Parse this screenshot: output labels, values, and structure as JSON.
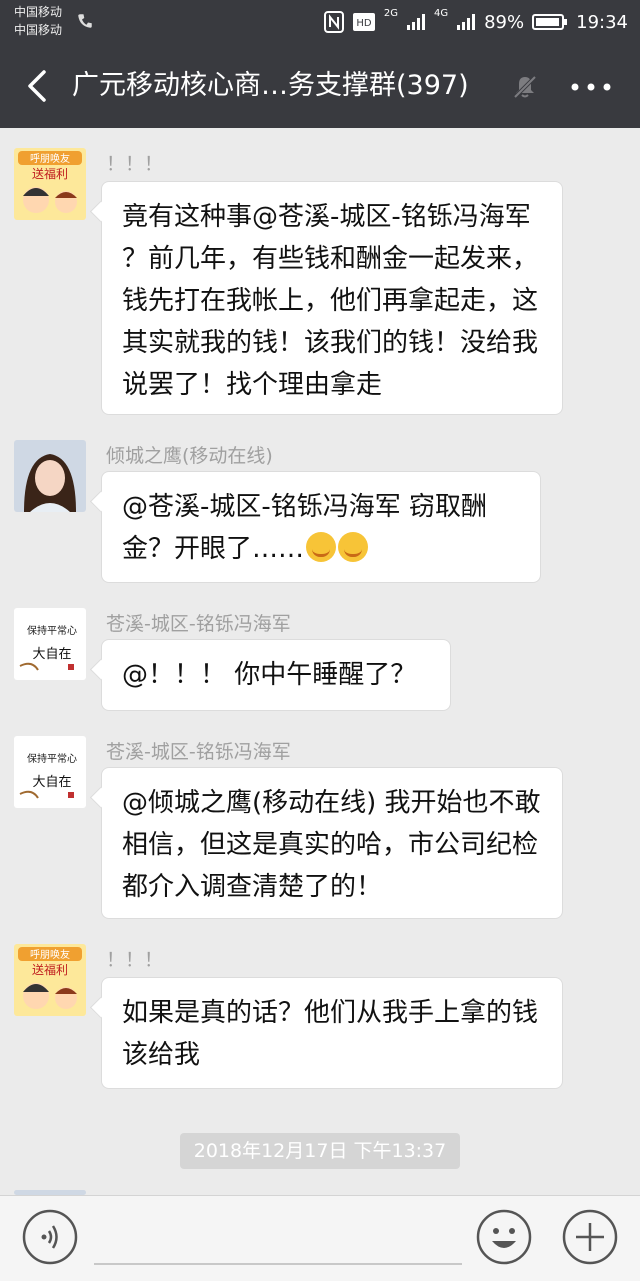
{
  "status_bar": {
    "carrier_1": "中国移动",
    "carrier_2": "中国移动",
    "network": "2G",
    "network_2": "4G",
    "battery": "89%",
    "time": "19:34"
  },
  "header": {
    "title": "广元移动核心商…务支撑群(397)"
  },
  "messages": [
    {
      "sender": "！！！",
      "text": "竟有这种事@苍溪-城区-铭铄冯海军 ？前几年，有些钱和酬金一起发来，钱先打在我帐上，他们再拿起走，这其实就我的钱！该我们的钱！没给我说罢了！找个理由拿走"
    },
    {
      "sender": "倾城之鹰(移动在线)",
      "text": "@苍溪-城区-铭铄冯海军  窃取酬金？开眼了……",
      "emoji_1": "smirk-emoji",
      "emoji_2": "smirk-emoji"
    },
    {
      "sender": "苍溪-城区-铭铄冯海军",
      "text": "@！！！  你中午睡醒了？"
    },
    {
      "sender": "苍溪-城区-铭铄冯海军",
      "text": "@倾城之鹰(移动在线) 我开始也不敢相信，但这是真实的哈，市公司纪检都介入调查清楚了的！"
    },
    {
      "sender": "！！！",
      "text": "如果是真的话？他们从我手上拿的钱该给我"
    }
  ],
  "timestamp": "2018年12月17日 下午13:37",
  "avatar_text": {
    "sticker_top": "呼朋唤友",
    "sticker_bottom": "送福利",
    "calligraphy_1": "保持平常心",
    "calligraphy_2": "大自在"
  },
  "colors": {
    "header_bg": "#393a3f",
    "chat_bg": "#ebebeb",
    "bubble_bg": "#ffffff",
    "timestamp_bg": "#d5d5d5"
  }
}
